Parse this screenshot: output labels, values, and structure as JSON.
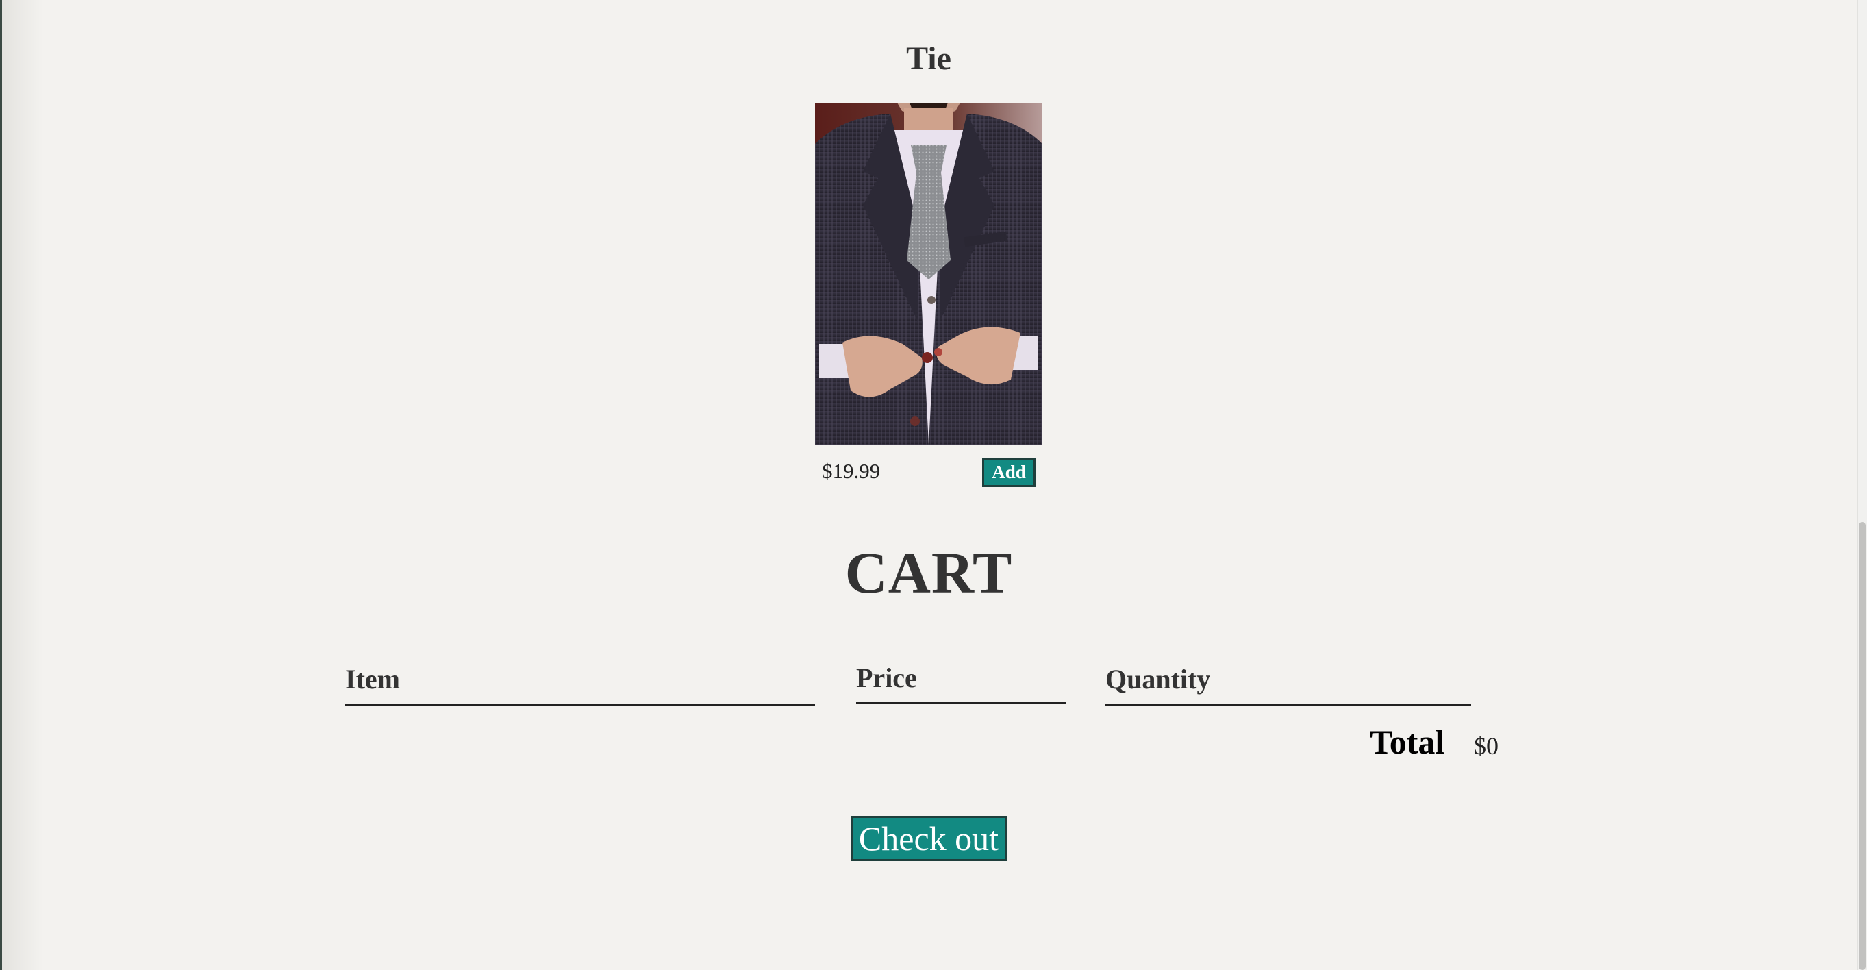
{
  "product": {
    "title": "Tie",
    "price": "$19.99",
    "add_label": "Add"
  },
  "cart": {
    "title": "CART",
    "columns": [
      "Item",
      "Price",
      "Quantity"
    ],
    "total_label": "Total",
    "total_value": "$0",
    "checkout_label": "Check out"
  },
  "colors": {
    "accent": "#128a82",
    "background": "#f3f2ef",
    "text": "#333333"
  }
}
